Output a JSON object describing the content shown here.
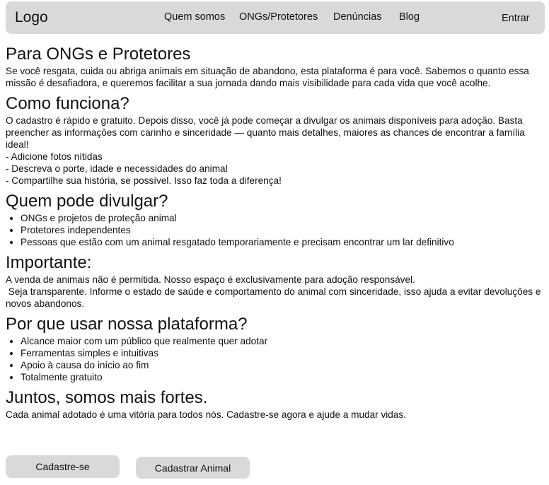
{
  "header": {
    "logo": "Logo",
    "nav": [
      "Quem somos",
      "ONGs/Protetores",
      "Denúncias",
      "Blog"
    ],
    "login": "Entrar"
  },
  "intro": {
    "title": "Para ONGs e Protetores",
    "text": "Se você resgata, cuida ou abriga animais em situação de abandono, esta plataforma é para você. Sabemos o quanto essa missão é desafiadora, e queremos facilitar a sua jornada dando mais visibilidade para cada vida que você acolhe."
  },
  "how": {
    "title": "Como funciona?",
    "text": "O cadastro é rápido e gratuito. Depois disso, você já pode começar a divulgar os animais disponíveis para adoção. Basta preencher as informações com carinho e sinceridade — quanto mais detalhes, maiores as chances de encontrar a família ideal!",
    "tips": [
      "- Adicione fotos nítidas",
      "- Descreva o porte, idade e necessidades do animal",
      "- Compartilhe sua história, se possível. Isso faz toda a diferença!"
    ]
  },
  "who": {
    "title": "Quem pode divulgar?",
    "items": [
      "ONGs e projetos de proteção animal",
      "Protetores independentes",
      "Pessoas que estão com um animal resgatado temporariamente e precisam encontrar um lar definitivo"
    ]
  },
  "important": {
    "title": "Importante:",
    "line1": "A venda de animais não é permitida. Nosso espaço é exclusivamente para adoção responsável.",
    "line2": " Seja transparente. Informe o estado de saúde e comportamento do animal com sinceridade, isso ajuda a evitar devoluções e novos abandonos."
  },
  "why": {
    "title": "Por que usar nossa plataforma?",
    "items": [
      "Alcance maior com um público que realmente quer adotar",
      "Ferramentas simples e intuitivas",
      "Apoio à causa do início ao fim",
      "Totalmente gratuito"
    ]
  },
  "together": {
    "title": "Juntos, somos mais fortes.",
    "text": "Cada animal adotado é uma vitória para todos nós. Cadastre-se agora e ajude a mudar vidas."
  },
  "buttons": {
    "signup": "Cadastre-se",
    "register_animal": "Cadastrar Animal"
  }
}
